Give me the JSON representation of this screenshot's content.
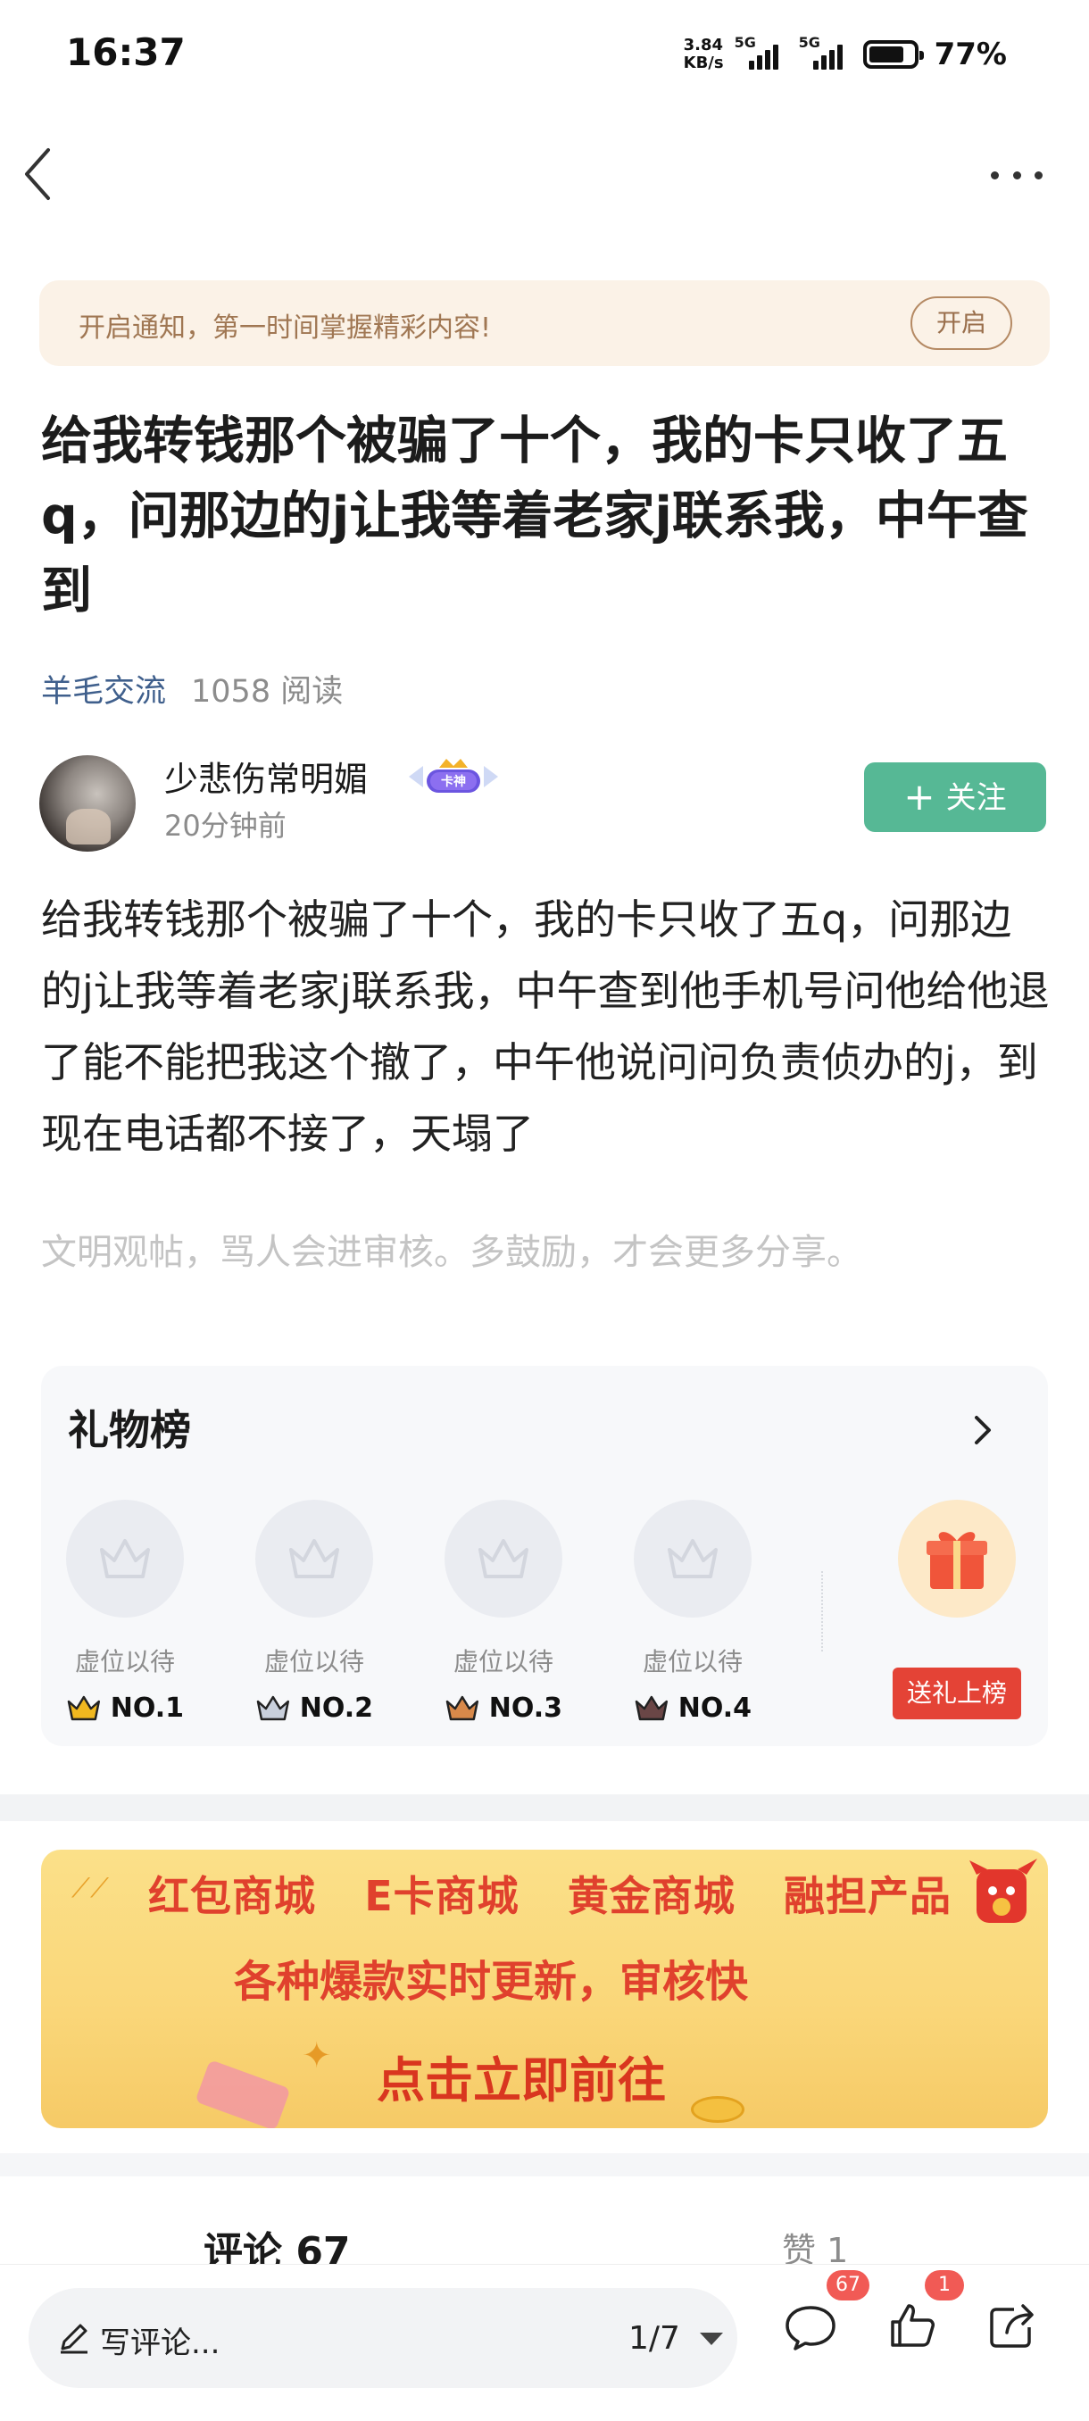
{
  "status_bar": {
    "time": "16:37",
    "net_speed_value": "3.84",
    "net_speed_unit": "KB/s",
    "signal1_label": "5G",
    "signal2_label": "5G",
    "battery": "77%"
  },
  "notify": {
    "text": "开启通知，第一时间掌握精彩内容!",
    "button": "开启"
  },
  "post": {
    "title": "给我转钱那个被骗了十个，我的卡只收了五q，问那边的j让我等着老家j联系我，中午查到",
    "tag": "羊毛交流",
    "reads": "1058 阅读",
    "author_name": "少悲伤常明媚",
    "author_badge": "卡神",
    "posted_ago": "20分钟前",
    "follow_label": "关注",
    "body": "给我转钱那个被骗了十个，我的卡只收了五q，问那边的j让我等着老家j联系我，中午查到他手机号问他给他退了能不能把我这个撤了，中午他说问问负责侦办的j，到现在电话都不接了，天塌了",
    "civil_hint": "文明观帖，骂人会进审核。多鼓励，才会更多分享。"
  },
  "gift_board": {
    "title": "礼物榜",
    "seats": [
      {
        "label": "虚位以待",
        "rank": "NO.1",
        "crown_color": "#f1b81f"
      },
      {
        "label": "虚位以待",
        "rank": "NO.2",
        "crown_color": "#8a93a6"
      },
      {
        "label": "虚位以待",
        "rank": "NO.3",
        "crown_color": "#d8894a"
      },
      {
        "label": "虚位以待",
        "rank": "NO.4",
        "crown_color": "#5a3f3f"
      }
    ],
    "send_button": "送礼上榜"
  },
  "ad": {
    "items": [
      "红包商城",
      "E卡商城",
      "黄金商城",
      "融担产品"
    ],
    "line2": "各种爆款实时更新，审核快",
    "cta": "点击立即前往"
  },
  "tabs": {
    "comments": "评论 67",
    "likes": "赞 1"
  },
  "bottom_bar": {
    "placeholder": "写评论...",
    "page": "1/7",
    "comment_count": "67",
    "like_count": "1"
  },
  "icons": [
    "back-arrow-icon",
    "more-dots-icon",
    "vip-badge-icon",
    "chevron-right-icon",
    "crown-icon",
    "gift-box-icon",
    "pen-icon",
    "comment-bubble-icon",
    "thumbs-up-icon",
    "share-icon"
  ],
  "colors": {
    "accent_green": "#56b895",
    "notify_bg": "#fbf2e7",
    "tag_blue": "#3f5f8c",
    "gift_red": "#e44336",
    "badge_red": "#f15a55"
  }
}
